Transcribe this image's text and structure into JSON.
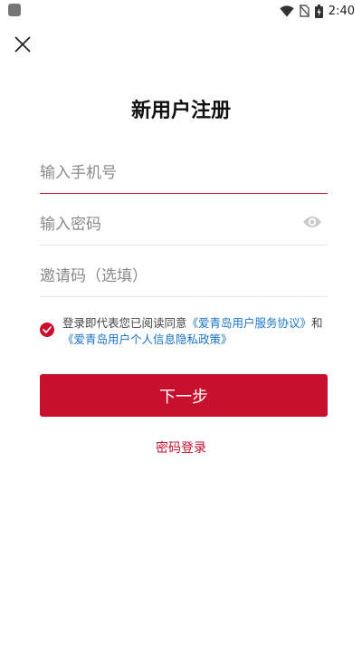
{
  "status_bar": {
    "time": "2:40",
    "icons": [
      "app-notification-icon",
      "wifi-icon",
      "no-sim-icon",
      "battery-charging-icon"
    ]
  },
  "header": {
    "close_icon": "close-icon",
    "title": "新用户注册"
  },
  "form": {
    "phone": {
      "value": "",
      "placeholder": "输入手机号"
    },
    "password": {
      "value": "",
      "placeholder": "输入密码",
      "toggle_icon": "eye-icon"
    },
    "invite": {
      "value": "",
      "placeholder": "邀请码（选填）"
    }
  },
  "agreement": {
    "checked": true,
    "prefix": "登录即代表您已阅读同意",
    "terms_link": "《爱青岛用户服务协议》",
    "conjunction": "和",
    "privacy_link": "《爱青岛用户个人信息隐私政策》"
  },
  "actions": {
    "next_label": "下一步",
    "password_login_label": "密码登录"
  },
  "colors": {
    "accent": "#c8102e",
    "link": "#1a73c8",
    "placeholder": "#8a8a8a"
  }
}
